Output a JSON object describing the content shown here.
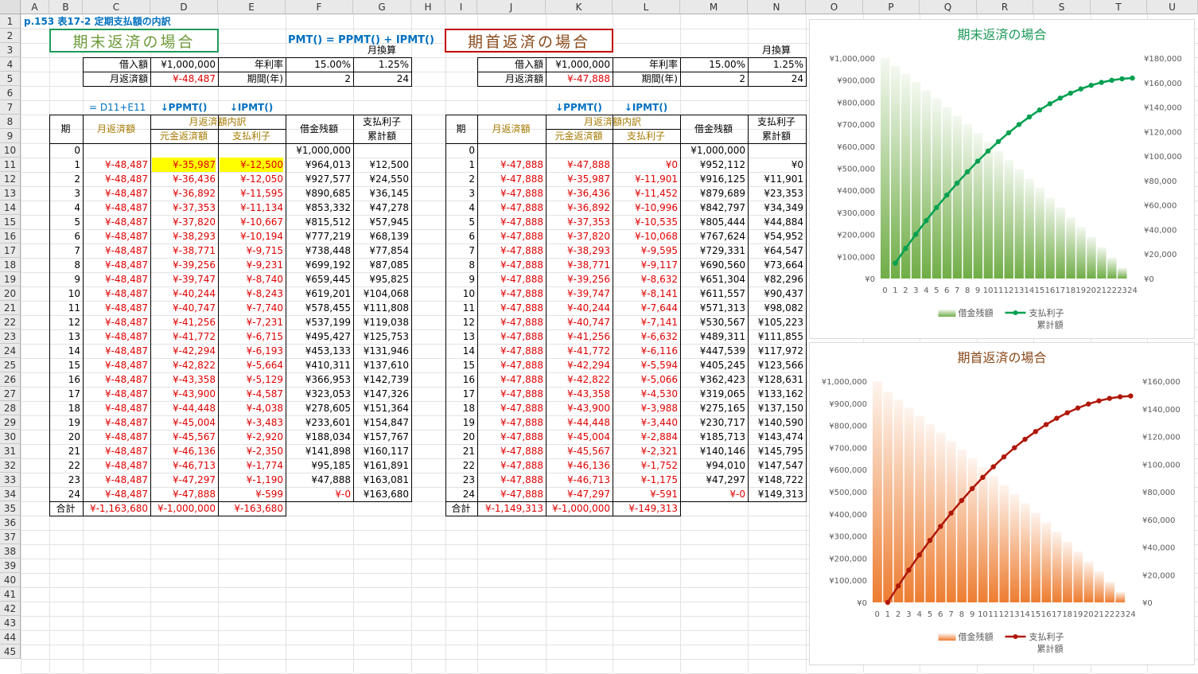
{
  "columns": [
    "A",
    "B",
    "C",
    "D",
    "E",
    "F",
    "G",
    "H",
    "I",
    "J",
    "K",
    "L",
    "M",
    "N",
    "O",
    "P",
    "Q",
    "R",
    "S",
    "T",
    "U"
  ],
  "rows": [
    1,
    2,
    3,
    4,
    5,
    6,
    7,
    8,
    9,
    10,
    11,
    12,
    13,
    14,
    15,
    16,
    17,
    18,
    19,
    20,
    21,
    22,
    23,
    24,
    25,
    26,
    27,
    28,
    29,
    30,
    31,
    32,
    33,
    34,
    35,
    36,
    37,
    38,
    39,
    40,
    41,
    42,
    43,
    44,
    45
  ],
  "page_title": "p.153 表17-2 定期支払額の内訳",
  "formula_note": "PMT() = PPMT() + IPMT()",
  "colors": {
    "green": "#1e9a5a",
    "red_text": "#e00000",
    "blue_text": "#0070c0",
    "gold_text": "#a57a00",
    "dark_red": "#c00000",
    "highlight": "#ffff00"
  },
  "left": {
    "banner": "期末返済の場合",
    "monthly_conv": "月換算",
    "loan_label": "借入額",
    "loan_value": "¥1,000,000",
    "rate_label": "年利率",
    "rate_value": "15.00%",
    "rate_monthly": "1.25%",
    "payment_label": "月返済額",
    "payment_value": "¥-48,487",
    "period_label": "期間(年)",
    "period_value": "2",
    "period_months": "24",
    "note_sum": "= D11+E11",
    "note_ppmt": "↓PPMT()",
    "note_ipmt": "↓IPMT()",
    "hdr_period": "期",
    "hdr_payment": "月返済額",
    "hdr_breakdown": "月返済額内訳",
    "hdr_principal": "元金返済額",
    "hdr_interest": "支払利子",
    "hdr_balance": "借金残額",
    "hdr_cum1": "支払利子",
    "hdr_cum2": "累計額",
    "row0_balance": "¥1,000,000",
    "rows": [
      [
        "1",
        "¥-48,487",
        "¥-35,987",
        "¥-12,500",
        "¥964,013",
        "¥12,500"
      ],
      [
        "2",
        "¥-48,487",
        "¥-36,436",
        "¥-12,050",
        "¥927,577",
        "¥24,550"
      ],
      [
        "3",
        "¥-48,487",
        "¥-36,892",
        "¥-11,595",
        "¥890,685",
        "¥36,145"
      ],
      [
        "4",
        "¥-48,487",
        "¥-37,353",
        "¥-11,134",
        "¥853,332",
        "¥47,278"
      ],
      [
        "5",
        "¥-48,487",
        "¥-37,820",
        "¥-10,667",
        "¥815,512",
        "¥57,945"
      ],
      [
        "6",
        "¥-48,487",
        "¥-38,293",
        "¥-10,194",
        "¥777,219",
        "¥68,139"
      ],
      [
        "7",
        "¥-48,487",
        "¥-38,771",
        "¥-9,715",
        "¥738,448",
        "¥77,854"
      ],
      [
        "8",
        "¥-48,487",
        "¥-39,256",
        "¥-9,231",
        "¥699,192",
        "¥87,085"
      ],
      [
        "9",
        "¥-48,487",
        "¥-39,747",
        "¥-8,740",
        "¥659,445",
        "¥95,825"
      ],
      [
        "10",
        "¥-48,487",
        "¥-40,244",
        "¥-8,243",
        "¥619,201",
        "¥104,068"
      ],
      [
        "11",
        "¥-48,487",
        "¥-40,747",
        "¥-7,740",
        "¥578,455",
        "¥111,808"
      ],
      [
        "12",
        "¥-48,487",
        "¥-41,256",
        "¥-7,231",
        "¥537,199",
        "¥119,038"
      ],
      [
        "13",
        "¥-48,487",
        "¥-41,772",
        "¥-6,715",
        "¥495,427",
        "¥125,753"
      ],
      [
        "14",
        "¥-48,487",
        "¥-42,294",
        "¥-6,193",
        "¥453,133",
        "¥131,946"
      ],
      [
        "15",
        "¥-48,487",
        "¥-42,822",
        "¥-5,664",
        "¥410,311",
        "¥137,610"
      ],
      [
        "16",
        "¥-48,487",
        "¥-43,358",
        "¥-5,129",
        "¥366,953",
        "¥142,739"
      ],
      [
        "17",
        "¥-48,487",
        "¥-43,900",
        "¥-4,587",
        "¥323,053",
        "¥147,326"
      ],
      [
        "18",
        "¥-48,487",
        "¥-44,448",
        "¥-4,038",
        "¥278,605",
        "¥151,364"
      ],
      [
        "19",
        "¥-48,487",
        "¥-45,004",
        "¥-3,483",
        "¥233,601",
        "¥154,847"
      ],
      [
        "20",
        "¥-48,487",
        "¥-45,567",
        "¥-2,920",
        "¥188,034",
        "¥157,767"
      ],
      [
        "21",
        "¥-48,487",
        "¥-46,136",
        "¥-2,350",
        "¥141,898",
        "¥160,117"
      ],
      [
        "22",
        "¥-48,487",
        "¥-46,713",
        "¥-1,774",
        "¥95,185",
        "¥161,891"
      ],
      [
        "23",
        "¥-48,487",
        "¥-47,297",
        "¥-1,190",
        "¥47,888",
        "¥163,081"
      ],
      [
        "24",
        "¥-48,487",
        "¥-47,888",
        "¥-599",
        "¥-0",
        "¥163,680"
      ]
    ],
    "total_label": "合計",
    "total_payment": "¥-1,163,680",
    "total_principal": "¥-1,000,000",
    "total_interest": "¥-163,680"
  },
  "right": {
    "banner": "期首返済の場合",
    "monthly_conv": "月換算",
    "loan_label": "借入額",
    "loan_value": "¥1,000,000",
    "rate_label": "年利率",
    "rate_value": "15.00%",
    "rate_monthly": "1.25%",
    "payment_label": "月返済額",
    "payment_value": "¥-47,888",
    "period_label": "期間(年)",
    "period_value": "2",
    "period_months": "24",
    "note_ppmt": "↓PPMT()",
    "note_ipmt": "↓IPMT()",
    "hdr_period": "期",
    "hdr_payment": "月返済額",
    "hdr_breakdown": "月返済額内訳",
    "hdr_principal": "元金返済額",
    "hdr_interest": "支払利子",
    "hdr_balance": "借金残額",
    "hdr_cum1": "支払利子",
    "hdr_cum2": "累計額",
    "row0_balance": "¥1,000,000",
    "rows": [
      [
        "1",
        "¥-47,888",
        "¥-47,888",
        "¥0",
        "¥952,112",
        "¥0"
      ],
      [
        "2",
        "¥-47,888",
        "¥-35,987",
        "¥-11,901",
        "¥916,125",
        "¥11,901"
      ],
      [
        "3",
        "¥-47,888",
        "¥-36,436",
        "¥-11,452",
        "¥879,689",
        "¥23,353"
      ],
      [
        "4",
        "¥-47,888",
        "¥-36,892",
        "¥-10,996",
        "¥842,797",
        "¥34,349"
      ],
      [
        "5",
        "¥-47,888",
        "¥-37,353",
        "¥-10,535",
        "¥805,444",
        "¥44,884"
      ],
      [
        "6",
        "¥-47,888",
        "¥-37,820",
        "¥-10,068",
        "¥767,624",
        "¥54,952"
      ],
      [
        "7",
        "¥-47,888",
        "¥-38,293",
        "¥-9,595",
        "¥729,331",
        "¥64,547"
      ],
      [
        "8",
        "¥-47,888",
        "¥-38,771",
        "¥-9,117",
        "¥690,560",
        "¥73,664"
      ],
      [
        "9",
        "¥-47,888",
        "¥-39,256",
        "¥-8,632",
        "¥651,304",
        "¥82,296"
      ],
      [
        "10",
        "¥-47,888",
        "¥-39,747",
        "¥-8,141",
        "¥611,557",
        "¥90,437"
      ],
      [
        "11",
        "¥-47,888",
        "¥-40,244",
        "¥-7,644",
        "¥571,313",
        "¥98,082"
      ],
      [
        "12",
        "¥-47,888",
        "¥-40,747",
        "¥-7,141",
        "¥530,567",
        "¥105,223"
      ],
      [
        "13",
        "¥-47,888",
        "¥-41,256",
        "¥-6,632",
        "¥489,311",
        "¥111,855"
      ],
      [
        "14",
        "¥-47,888",
        "¥-41,772",
        "¥-6,116",
        "¥447,539",
        "¥117,972"
      ],
      [
        "15",
        "¥-47,888",
        "¥-42,294",
        "¥-5,594",
        "¥405,245",
        "¥123,566"
      ],
      [
        "16",
        "¥-47,888",
        "¥-42,822",
        "¥-5,066",
        "¥362,423",
        "¥128,631"
      ],
      [
        "17",
        "¥-47,888",
        "¥-43,358",
        "¥-4,530",
        "¥319,065",
        "¥133,162"
      ],
      [
        "18",
        "¥-47,888",
        "¥-43,900",
        "¥-3,988",
        "¥275,165",
        "¥137,150"
      ],
      [
        "19",
        "¥-47,888",
        "¥-44,448",
        "¥-3,440",
        "¥230,717",
        "¥140,590"
      ],
      [
        "20",
        "¥-47,888",
        "¥-45,004",
        "¥-2,884",
        "¥185,713",
        "¥143,474"
      ],
      [
        "21",
        "¥-47,888",
        "¥-45,567",
        "¥-2,321",
        "¥140,146",
        "¥145,795"
      ],
      [
        "22",
        "¥-47,888",
        "¥-46,136",
        "¥-1,752",
        "¥94,010",
        "¥147,547"
      ],
      [
        "23",
        "¥-47,888",
        "¥-46,713",
        "¥-1,175",
        "¥47,297",
        "¥148,722"
      ],
      [
        "24",
        "¥-47,888",
        "¥-47,297",
        "¥-591",
        "¥-0",
        "¥149,313"
      ]
    ],
    "total_label": "合計",
    "total_payment": "¥-1,149,313",
    "total_principal": "¥-1,000,000",
    "total_interest": "¥-149,313"
  },
  "chart_data": [
    {
      "type": "bar",
      "title": "期末返済の場合",
      "categories": [
        "0",
        "1",
        "2",
        "3",
        "4",
        "5",
        "6",
        "7",
        "8",
        "9",
        "10",
        "11",
        "12",
        "13",
        "14",
        "15",
        "16",
        "17",
        "18",
        "19",
        "20",
        "21",
        "22",
        "23",
        "24"
      ],
      "series": [
        {
          "name": "借金残額",
          "kind": "bar",
          "axis": "left",
          "color": "#70ad47",
          "values": [
            1000000,
            964013,
            927577,
            890685,
            853332,
            815512,
            777219,
            738448,
            699192,
            659445,
            619201,
            578455,
            537199,
            495427,
            453133,
            410311,
            366953,
            323053,
            278605,
            233601,
            188034,
            141898,
            95185,
            47888,
            0
          ]
        },
        {
          "name": "支払利子累計額",
          "kind": "line",
          "axis": "right",
          "color": "#00a050",
          "values": [
            null,
            12500,
            24550,
            36145,
            47278,
            57945,
            68139,
            77854,
            87085,
            95825,
            104068,
            111808,
            119038,
            125753,
            131946,
            137610,
            142739,
            147326,
            151364,
            154847,
            157767,
            160117,
            161891,
            163081,
            163680
          ]
        }
      ],
      "legend_bar": "借金残額",
      "legend_line_1": "支払利子",
      "legend_line_2": "累計額",
      "ylim_left": [
        0,
        1000000
      ],
      "ylim_right": [
        0,
        180000
      ],
      "yticks_left": [
        "¥0",
        "¥100,000",
        "¥200,000",
        "¥300,000",
        "¥400,000",
        "¥500,000",
        "¥600,000",
        "¥700,000",
        "¥800,000",
        "¥900,000",
        "¥1,000,000"
      ],
      "yticks_right": [
        "¥0",
        "¥20,000",
        "¥40,000",
        "¥60,000",
        "¥80,000",
        "¥100,000",
        "¥120,000",
        "¥140,000",
        "¥160,000",
        "¥180,000"
      ],
      "legend": "bottom"
    },
    {
      "type": "bar",
      "title": "期首返済の場合",
      "categories": [
        "0",
        "1",
        "2",
        "3",
        "4",
        "5",
        "6",
        "7",
        "8",
        "9",
        "10",
        "11",
        "12",
        "13",
        "14",
        "15",
        "16",
        "17",
        "18",
        "19",
        "20",
        "21",
        "22",
        "23",
        "24"
      ],
      "series": [
        {
          "name": "借金残額",
          "kind": "bar",
          "axis": "left",
          "color": "#ed7d31",
          "values": [
            1000000,
            952112,
            916125,
            879689,
            842797,
            805444,
            767624,
            729331,
            690560,
            651304,
            611557,
            571313,
            530567,
            489311,
            447539,
            405245,
            362423,
            319065,
            275165,
            230717,
            185713,
            140146,
            94010,
            47297,
            0
          ]
        },
        {
          "name": "支払利子累計額",
          "kind": "line",
          "axis": "right",
          "color": "#b0180a",
          "values": [
            null,
            0,
            11901,
            23353,
            34349,
            44884,
            54952,
            64547,
            73664,
            82296,
            90437,
            98082,
            105223,
            111855,
            117972,
            123566,
            128631,
            133162,
            137150,
            140590,
            143474,
            145795,
            147547,
            148722,
            149313
          ]
        }
      ],
      "legend_bar": "借金残額",
      "legend_line_1": "支払利子",
      "legend_line_2": "累計額",
      "ylim_left": [
        0,
        1000000
      ],
      "ylim_right": [
        0,
        160000
      ],
      "yticks_left": [
        "¥0",
        "¥100,000",
        "¥200,000",
        "¥300,000",
        "¥400,000",
        "¥500,000",
        "¥600,000",
        "¥700,000",
        "¥800,000",
        "¥900,000",
        "¥1,000,000"
      ],
      "yticks_right": [
        "¥0",
        "¥20,000",
        "¥40,000",
        "¥60,000",
        "¥80,000",
        "¥100,000",
        "¥120,000",
        "¥140,000",
        "¥160,000"
      ],
      "legend": "bottom"
    }
  ]
}
